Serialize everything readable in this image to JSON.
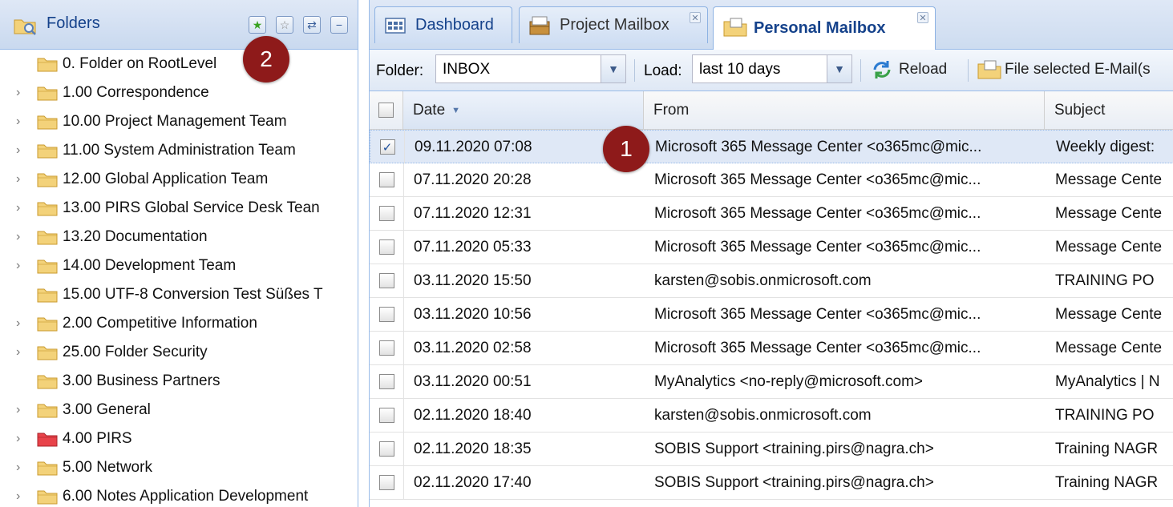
{
  "folders_panel": {
    "title": "Folders",
    "tools": [
      "star-add-icon",
      "star-icon",
      "refresh-icon",
      "collapse-icon"
    ],
    "items": [
      {
        "label": "0. Folder on RootLevel",
        "expandable": false,
        "color": "yellow"
      },
      {
        "label": "1.00 Correspondence",
        "expandable": true,
        "color": "yellow"
      },
      {
        "label": "10.00 Project Management Team",
        "expandable": true,
        "color": "yellow"
      },
      {
        "label": "11.00 System Administration Team",
        "expandable": true,
        "color": "yellow"
      },
      {
        "label": "12.00 Global Application Team",
        "expandable": true,
        "color": "yellow"
      },
      {
        "label": "13.00 PIRS Global Service Desk Tean",
        "expandable": true,
        "color": "yellow"
      },
      {
        "label": "13.20 Documentation",
        "expandable": true,
        "color": "yellow"
      },
      {
        "label": "14.00 Development Team",
        "expandable": true,
        "color": "yellow"
      },
      {
        "label": "15.00 UTF-8 Conversion Test Süßes T",
        "expandable": false,
        "color": "yellow"
      },
      {
        "label": "2.00 Competitive Information",
        "expandable": true,
        "color": "yellow"
      },
      {
        "label": "25.00 Folder Security",
        "expandable": true,
        "color": "yellow"
      },
      {
        "label": "3.00 Business Partners",
        "expandable": false,
        "color": "yellow"
      },
      {
        "label": "3.00 General",
        "expandable": true,
        "color": "yellow"
      },
      {
        "label": "4.00 PIRS",
        "expandable": true,
        "color": "red"
      },
      {
        "label": "5.00 Network",
        "expandable": true,
        "color": "yellow"
      },
      {
        "label": "6.00 Notes Application Development",
        "expandable": true,
        "color": "yellow"
      }
    ]
  },
  "tabs": [
    {
      "label": "Dashboard",
      "icon": "dashboard-icon",
      "closable": false,
      "active": false
    },
    {
      "label": "Project Mailbox",
      "icon": "mailbox-icon",
      "closable": true,
      "active": false
    },
    {
      "label": "Personal Mailbox",
      "icon": "folder-mail-icon",
      "closable": true,
      "active": true
    }
  ],
  "toolbar": {
    "folder_label": "Folder:",
    "folder_value": "INBOX",
    "load_label": "Load:",
    "load_value": "last 10 days",
    "reload_label": "Reload",
    "file_label": "File selected E-Mail(s"
  },
  "grid": {
    "columns": [
      "Date",
      "From",
      "Subject"
    ],
    "sort_indicator": "▼",
    "rows": [
      {
        "date": "09.11.2020 07:08",
        "from": "Microsoft 365 Message Center <o365mc@mic...",
        "subject": "Weekly digest:",
        "selected": true
      },
      {
        "date": "07.11.2020 20:28",
        "from": "Microsoft 365 Message Center <o365mc@mic...",
        "subject": "Message Cente",
        "selected": false
      },
      {
        "date": "07.11.2020 12:31",
        "from": "Microsoft 365 Message Center <o365mc@mic...",
        "subject": "Message Cente",
        "selected": false
      },
      {
        "date": "07.11.2020 05:33",
        "from": "Microsoft 365 Message Center <o365mc@mic...",
        "subject": "Message Cente",
        "selected": false
      },
      {
        "date": "03.11.2020 15:50",
        "from": "karsten@sobis.onmicrosoft.com",
        "subject": "TRAINING PO",
        "selected": false
      },
      {
        "date": "03.11.2020 10:56",
        "from": "Microsoft 365 Message Center <o365mc@mic...",
        "subject": "Message Cente",
        "selected": false
      },
      {
        "date": "03.11.2020 02:58",
        "from": "Microsoft 365 Message Center <o365mc@mic...",
        "subject": "Message Cente",
        "selected": false
      },
      {
        "date": "03.11.2020 00:51",
        "from": "MyAnalytics <no-reply@microsoft.com>",
        "subject": "MyAnalytics | N",
        "selected": false
      },
      {
        "date": "02.11.2020 18:40",
        "from": "karsten@sobis.onmicrosoft.com",
        "subject": "TRAINING PO",
        "selected": false
      },
      {
        "date": "02.11.2020 18:35",
        "from": "SOBIS Support <training.pirs@nagra.ch>",
        "subject": "Training NAGR",
        "selected": false
      },
      {
        "date": "02.11.2020 17:40",
        "from": "SOBIS Support <training.pirs@nagra.ch>",
        "subject": "Training NAGR",
        "selected": false
      }
    ]
  },
  "callouts": [
    "1",
    "2"
  ],
  "colors": {
    "panel_header": "#dfe8f6",
    "selected_row": "#dfe8f6",
    "callout_badge": "#8e1a1a",
    "header_text": "#15428b"
  }
}
